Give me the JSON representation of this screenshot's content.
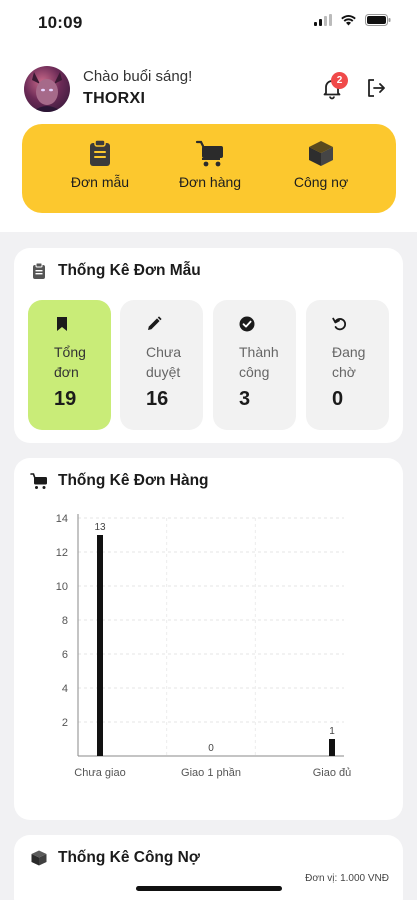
{
  "status_bar": {
    "time": "10:09"
  },
  "header": {
    "greeting": "Chào buổi sáng!",
    "username": "THORXI",
    "notification_count": "2"
  },
  "quick_actions": [
    {
      "label": "Đơn mẫu",
      "icon": "clipboard-icon"
    },
    {
      "label": "Đơn hàng",
      "icon": "cart-icon"
    },
    {
      "label": "Công nợ",
      "icon": "box-icon"
    }
  ],
  "sample_stats": {
    "title": "Thống Kê Đơn Mẫu",
    "items": [
      {
        "label": "Tổng đơn",
        "value": "19",
        "icon": "bookmark-icon"
      },
      {
        "label": "Chưa duyệt",
        "value": "16",
        "icon": "pencil-icon"
      },
      {
        "label": "Thành công",
        "value": "3",
        "icon": "check-circle-icon"
      },
      {
        "label": "Đang chờ",
        "value": "0",
        "icon": "refresh-icon"
      }
    ]
  },
  "order_stats": {
    "title": "Thống Kê Đơn Hàng"
  },
  "chart_data": {
    "type": "bar",
    "categories": [
      "Chưa giao",
      "Giao 1 phần",
      "Giao đủ"
    ],
    "values": [
      13,
      0,
      1
    ],
    "ylim": [
      0,
      14
    ],
    "yticks": [
      2,
      4,
      6,
      8,
      10,
      12,
      14
    ],
    "grid": true,
    "bar_color": "#111111"
  },
  "debt_stats": {
    "title": "Thống Kê Công Nợ",
    "unit_note": "Đơn vị: 1.000 VNĐ"
  },
  "colors": {
    "accent_yellow": "#fcc82e",
    "active_green": "#c9ec78",
    "badge_red": "#f04a4a"
  }
}
